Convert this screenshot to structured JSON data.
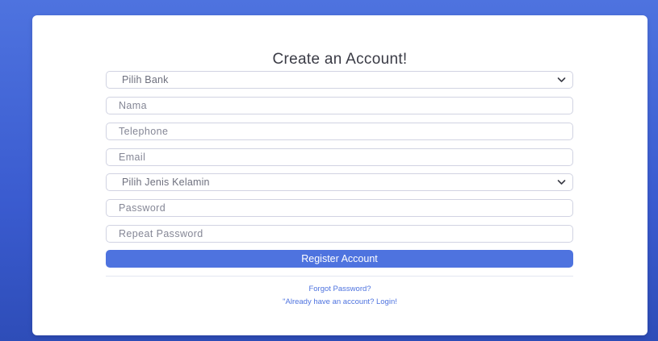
{
  "form": {
    "title": "Create an Account!",
    "bank_select": {
      "selected": "Pilih Bank",
      "icon": "chevron-down-icon"
    },
    "name_placeholder": "Nama",
    "telephone_placeholder": "Telephone",
    "email_placeholder": "Email",
    "gender_select": {
      "selected": "Pilih Jenis Kelamin",
      "icon": "chevron-down-icon"
    },
    "password_placeholder": "Password",
    "repeat_password_placeholder": "Repeat Password",
    "register_label": "Register Account",
    "forgot_password_label": "Forgot Password?",
    "login_label": "\"Already have an account? Login!"
  },
  "colors": {
    "primary": "#4e73df",
    "background": "#4e73df",
    "card": "#ffffff",
    "title_text": "#3a3b45",
    "input_border": "#d1d3e2"
  }
}
